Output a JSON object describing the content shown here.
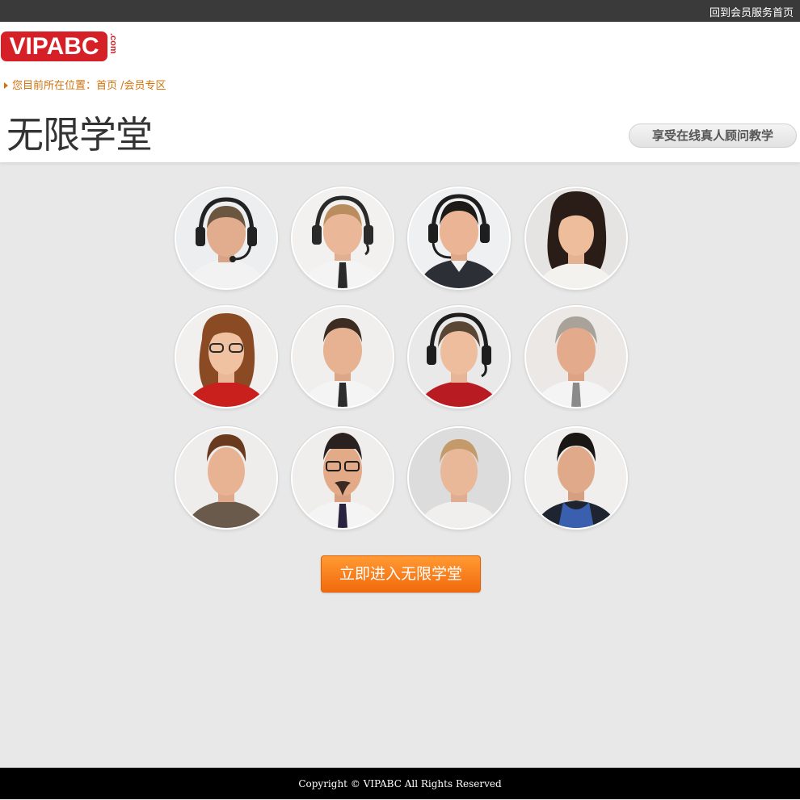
{
  "topbar": {
    "member_home_link": "回到会员服务首页"
  },
  "logo": {
    "text": "VIPABC",
    "suffix": ".com"
  },
  "breadcrumb": {
    "prefix": "您目前所在位置：",
    "home": "首页",
    "separator": " /",
    "current": "会员专区"
  },
  "page": {
    "title": "无限学堂",
    "slogan": "享受在线真人顾问教学"
  },
  "cta": {
    "label": "立即进入无限学堂"
  },
  "footer": {
    "copyright": "Copyright © VIPABC All Rights Reserved"
  },
  "colors": {
    "brand_red": "#d62027",
    "accent_orange": "#f26a0c",
    "breadcrumb_orange": "#d4710b",
    "topbar": "#3a3a3a"
  }
}
